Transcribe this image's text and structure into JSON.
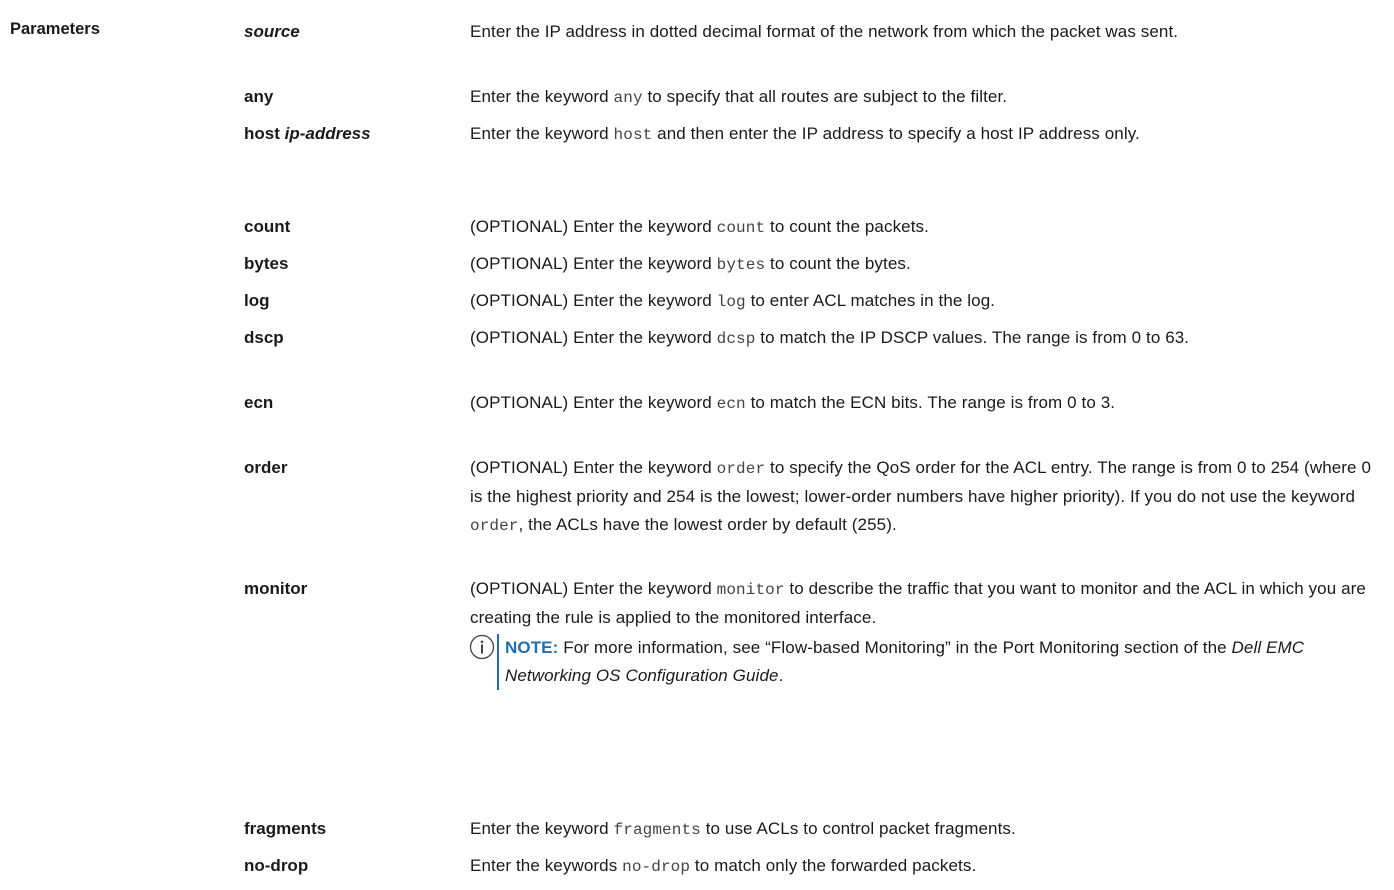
{
  "section_title": "Parameters",
  "rows": [
    {
      "term_plain": "",
      "term_italic": "source",
      "desc": [
        {
          "t": "Enter the IP address in dotted decimal format of the network from which the packet was sent.",
          "mono": false
        }
      ]
    },
    {
      "term_plain": "any",
      "term_italic": "",
      "desc": [
        {
          "t": "Enter the keyword ",
          "mono": false
        },
        {
          "t": "any",
          "mono": true
        },
        {
          "t": " to specify that all routes are subject to the filter.",
          "mono": false
        }
      ]
    },
    {
      "term_plain": "host ",
      "term_italic": "ip-address",
      "desc": [
        {
          "t": "Enter the keyword ",
          "mono": false
        },
        {
          "t": "host",
          "mono": true
        },
        {
          "t": " and then enter the IP address to specify a host IP address only.",
          "mono": false
        }
      ]
    },
    {
      "term_plain": "count",
      "term_italic": "",
      "desc": [
        {
          "t": "(OPTIONAL) Enter the keyword ",
          "mono": false
        },
        {
          "t": "count",
          "mono": true
        },
        {
          "t": " to count the packets.",
          "mono": false
        }
      ]
    },
    {
      "term_plain": "bytes",
      "term_italic": "",
      "desc": [
        {
          "t": "(OPTIONAL) Enter the keyword ",
          "mono": false
        },
        {
          "t": "bytes",
          "mono": true
        },
        {
          "t": " to count the bytes.",
          "mono": false
        }
      ]
    },
    {
      "term_plain": "log",
      "term_italic": "",
      "desc": [
        {
          "t": "(OPTIONAL) Enter the keyword ",
          "mono": false
        },
        {
          "t": "log",
          "mono": true
        },
        {
          "t": " to enter ACL matches in the log.",
          "mono": false
        }
      ]
    },
    {
      "term_plain": "dscp",
      "term_italic": "",
      "desc": [
        {
          "t": "(OPTIONAL) Enter the keyword ",
          "mono": false
        },
        {
          "t": "dcsp",
          "mono": true
        },
        {
          "t": " to match the IP DSCP values. The range is from 0 to 63.",
          "mono": false
        }
      ]
    },
    {
      "term_plain": "ecn",
      "term_italic": "",
      "desc": [
        {
          "t": "(OPTIONAL) Enter the keyword ",
          "mono": false
        },
        {
          "t": "ecn",
          "mono": true
        },
        {
          "t": " to match the ECN bits. The range is from 0 to 3.",
          "mono": false
        }
      ]
    },
    {
      "term_plain": "order",
      "term_italic": "",
      "desc": [
        {
          "t": "(OPTIONAL) Enter the keyword ",
          "mono": false
        },
        {
          "t": "order",
          "mono": true
        },
        {
          "t": " to specify the QoS order for the ACL entry. The range is from 0 to 254 (where 0 is the highest priority and 254 is the lowest; lower-order numbers have higher priority). If you do not use the keyword ",
          "mono": false
        },
        {
          "t": "order",
          "mono": true
        },
        {
          "t": ", the ACLs have the lowest order by default (255).",
          "mono": false
        }
      ]
    },
    {
      "term_plain": "monitor",
      "term_italic": "",
      "desc": [
        {
          "t": "(OPTIONAL) Enter the keyword ",
          "mono": false
        },
        {
          "t": "monitor",
          "mono": true
        },
        {
          "t": " to describe the traffic that you want to monitor and the ACL in which you are creating the rule is applied to the monitored interface.",
          "mono": false
        }
      ],
      "note": {
        "label": "NOTE:",
        "parts": [
          {
            "t": " For more information, see “Flow-based Monitoring” in the Port Monitoring section of the ",
            "ital": false
          },
          {
            "t": "Dell EMC Networking OS Configuration Guide",
            "ital": true
          },
          {
            "t": ".",
            "ital": false
          }
        ]
      }
    },
    {
      "term_plain": "fragments",
      "term_italic": "",
      "desc": [
        {
          "t": "Enter the keyword ",
          "mono": false
        },
        {
          "t": "fragments",
          "mono": true
        },
        {
          "t": " to use ACLs to control packet fragments.",
          "mono": false
        }
      ]
    },
    {
      "term_plain": "no-drop",
      "term_italic": "",
      "desc": [
        {
          "t": "Enter the keywords ",
          "mono": false
        },
        {
          "t": "no-drop",
          "mono": true
        },
        {
          "t": " to match only the forwarded packets.",
          "mono": false
        }
      ]
    }
  ]
}
